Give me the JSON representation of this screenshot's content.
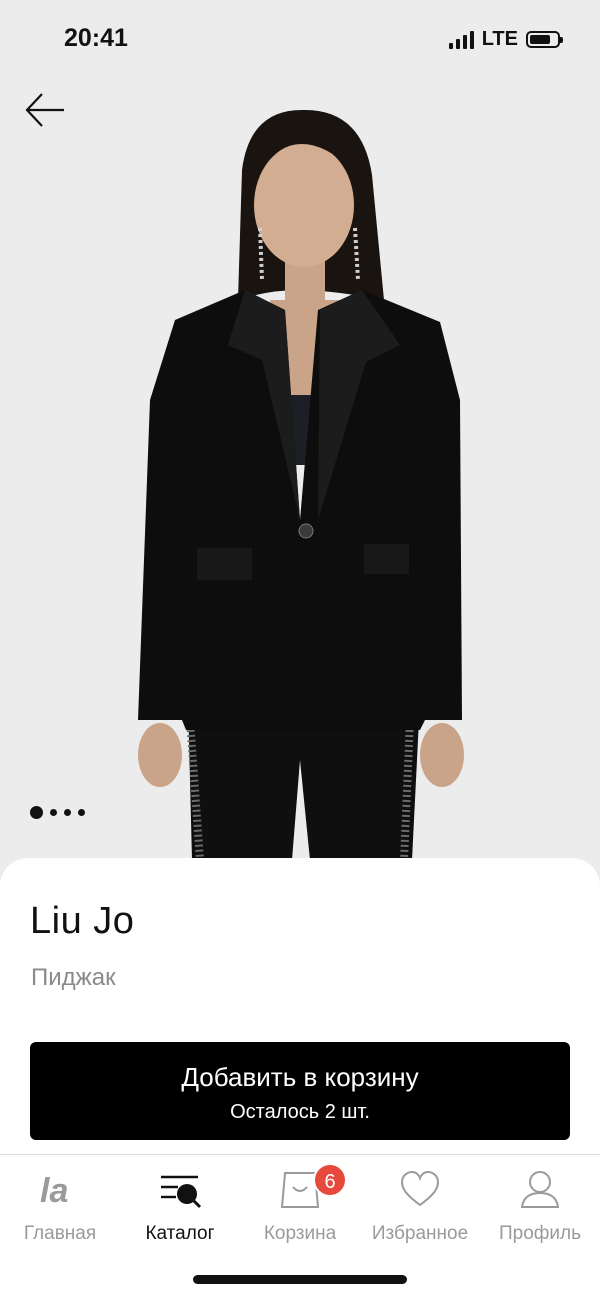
{
  "status_bar": {
    "time": "20:41",
    "network": "LTE"
  },
  "product": {
    "brand": "Liu Jo",
    "type": "Пиджак",
    "image_count": 4,
    "current_image": 1,
    "image_description": "model in black single-button blazer"
  },
  "actions": {
    "add_to_cart": "Добавить в корзину",
    "stock_note": "Осталось 2 шт."
  },
  "tabbar": {
    "items": [
      {
        "label": "Главная",
        "icon": "la-logo-icon",
        "active": false
      },
      {
        "label": "Каталог",
        "icon": "catalog-search-icon",
        "active": true
      },
      {
        "label": "Корзина",
        "icon": "shopping-bag-icon",
        "active": false,
        "badge": "6"
      },
      {
        "label": "Избранное",
        "icon": "heart-icon",
        "active": false
      },
      {
        "label": "Профиль",
        "icon": "profile-icon",
        "active": false
      }
    ]
  },
  "colors": {
    "badge": "#e8493d",
    "button": "#000000",
    "inactive": "#9a9a9a"
  }
}
